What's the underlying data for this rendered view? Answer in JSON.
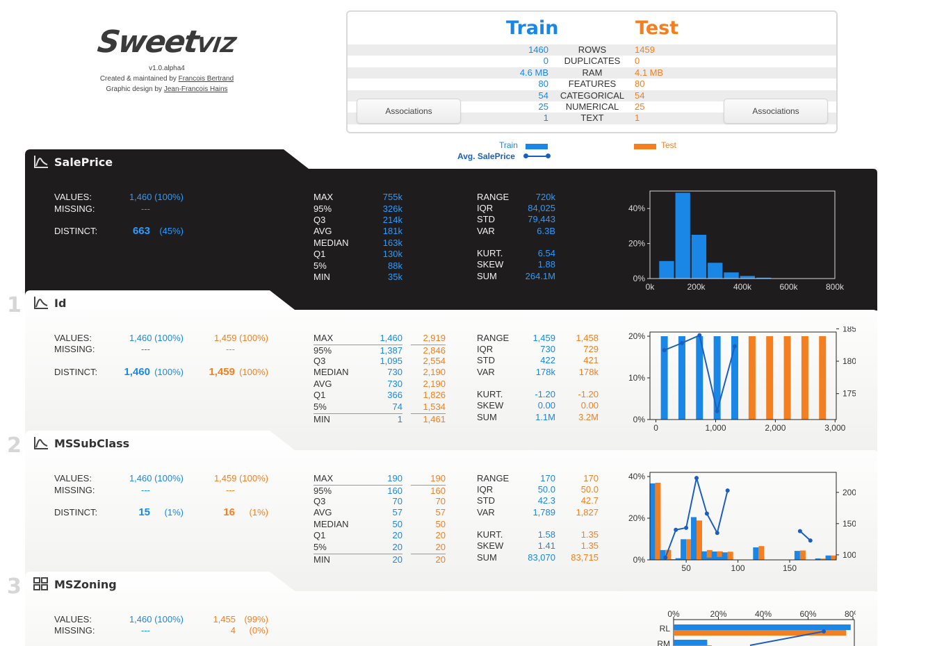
{
  "logo": {
    "word_main": "Sweet",
    "word_viz": "VIZ",
    "version": "v1.0.alpha4",
    "created_prefix": "Created & maintained by ",
    "created_name": "Francois Bertrand",
    "design_prefix": "Graphic design by ",
    "design_name": "Jean-Francois Hains"
  },
  "summary": {
    "train_label": "Train",
    "test_label": "Test",
    "rows": [
      {
        "label": "ROWS",
        "train": "1460",
        "test": "1459"
      },
      {
        "label": "DUPLICATES",
        "train": "0",
        "test": "0"
      },
      {
        "label": "RAM",
        "train": "4.6 MB",
        "test": "4.1 MB"
      },
      {
        "label": "FEATURES",
        "train": "80",
        "test": "80"
      },
      {
        "label": "CATEGORICAL",
        "train": "54",
        "test": "54"
      },
      {
        "label": "NUMERICAL",
        "train": "25",
        "test": "25"
      },
      {
        "label": "TEXT",
        "train": "1",
        "test": "1"
      }
    ],
    "associations_left": "Associations",
    "associations_right": "Associations"
  },
  "legend": {
    "train": "Train",
    "test": "Test",
    "avg": "Avg. SalePrice"
  },
  "colors": {
    "train": "#1a87e6",
    "test": "#f47f20",
    "avg_line": "#1a5fbf",
    "dark_bg": "#1e1c1c"
  },
  "features": {
    "saleprice": {
      "name": "SalePrice",
      "values_label": "VALUES:",
      "missing_label": "MISSING:",
      "distinct_label": "DISTINCT:",
      "values": "1,460 (100%)",
      "missing": "---",
      "distinct": "663",
      "distinct_pct": "(45%)",
      "quant_labels": [
        "MAX",
        "95%",
        "Q3",
        "AVG",
        "MEDIAN",
        "Q1",
        "5%",
        "MIN"
      ],
      "quant_train": [
        "755k",
        "326k",
        "214k",
        "181k",
        "163k",
        "130k",
        "88k",
        "35k"
      ],
      "stat_labels": [
        "RANGE",
        "IQR",
        "STD",
        "VAR"
      ],
      "stat_train": [
        "720k",
        "84,025",
        "79,443",
        "6.3B"
      ],
      "shape_labels": [
        "KURT.",
        "SKEW",
        "SUM"
      ],
      "shape_train": [
        "6.54",
        "1.88",
        "264.1M"
      ]
    },
    "id": {
      "index": "1",
      "name": "Id",
      "values_label": "VALUES:",
      "missing_label": "MISSING:",
      "distinct_label": "DISTINCT:",
      "values_train": "1,460 (100%)",
      "values_test": "1,459 (100%)",
      "missing_train": "---",
      "missing_test": "---",
      "distinct_train": "1,460",
      "distinct_train_pct": "(100%)",
      "distinct_test": "1,459",
      "distinct_test_pct": "(100%)",
      "quant_labels": [
        "MAX",
        "95%",
        "Q3",
        "MEDIAN",
        "AVG",
        "Q1",
        "5%",
        "MIN"
      ],
      "quant_train": [
        "1,460",
        "1,387",
        "1,095",
        "730",
        "730",
        "366",
        "74",
        "1"
      ],
      "quant_test": [
        "2,919",
        "2,846",
        "2,554",
        "2,190",
        "2,190",
        "1,826",
        "1,534",
        "1,461"
      ],
      "stat_labels": [
        "RANGE",
        "IQR",
        "STD",
        "VAR"
      ],
      "stat_train": [
        "1,459",
        "730",
        "422",
        "178k"
      ],
      "stat_test": [
        "1,458",
        "729",
        "421",
        "178k"
      ],
      "shape_labels": [
        "KURT.",
        "SKEW",
        "SUM"
      ],
      "shape_train": [
        "-1.20",
        "0.00",
        "1.1M"
      ],
      "shape_test": [
        "-1.20",
        "0.00",
        "3.2M"
      ]
    },
    "mssubclass": {
      "index": "2",
      "name": "MSSubClass",
      "values_label": "VALUES:",
      "missing_label": "MISSING:",
      "distinct_label": "DISTINCT:",
      "values_train": "1,460 (100%)",
      "values_test": "1,459 (100%)",
      "missing_train": "---",
      "missing_test": "---",
      "distinct_train": "15",
      "distinct_train_pct": "(1%)",
      "distinct_test": "16",
      "distinct_test_pct": "(1%)",
      "quant_labels": [
        "MAX",
        "95%",
        "Q3",
        "AVG",
        "MEDIAN",
        "Q1",
        "5%",
        "MIN"
      ],
      "quant_train": [
        "190",
        "160",
        "70",
        "57",
        "50",
        "20",
        "20",
        "20"
      ],
      "quant_test": [
        "190",
        "160",
        "70",
        "57",
        "50",
        "20",
        "20",
        "20"
      ],
      "stat_labels": [
        "RANGE",
        "IQR",
        "STD",
        "VAR"
      ],
      "stat_train": [
        "170",
        "50.0",
        "42.3",
        "1,789"
      ],
      "stat_test": [
        "170",
        "50.0",
        "42.7",
        "1,827"
      ],
      "shape_labels": [
        "KURT.",
        "SKEW",
        "SUM"
      ],
      "shape_train": [
        "1.58",
        "1.41",
        "83,070"
      ],
      "shape_test": [
        "1.35",
        "1.35",
        "83,715"
      ]
    },
    "mszoning": {
      "index": "3",
      "name": "MSZoning",
      "values_label": "VALUES:",
      "missing_label": "MISSING:",
      "values_train": "1,460 (100%)",
      "values_test": "1,455",
      "values_test_pct": "(99%)",
      "missing_train": "---",
      "missing_test": "4",
      "missing_test_pct": "(0%)"
    }
  },
  "chart_data": [
    {
      "type": "bar",
      "feature": "SalePrice",
      "x_ticks": [
        "0k",
        "200k",
        "400k",
        "600k",
        "800k"
      ],
      "y_ticks": [
        "0%",
        "20%",
        "40%"
      ],
      "xlim": [
        0,
        800000
      ],
      "ylim": [
        0,
        0.5
      ],
      "bin_starts": [
        40000,
        110000,
        180000,
        250000,
        320000,
        390000,
        460000,
        530000,
        600000,
        670000
      ],
      "bin_width": 64000,
      "values": [
        0.1,
        0.49,
        0.25,
        0.09,
        0.035,
        0.015,
        0.005,
        0.002,
        0.001,
        0.001
      ]
    },
    {
      "type": "bar",
      "feature": "Id",
      "x_ticks": [
        "0",
        "1,000",
        "2,000",
        "3,000"
      ],
      "y_ticks": [
        "0%",
        "10%",
        "20%"
      ],
      "y2_ticks": [
        "175k",
        "180k",
        "185k"
      ],
      "xlim": [
        -100,
        3020
      ],
      "ylim": [
        0,
        0.2
      ],
      "y2lim": [
        171000,
        184500
      ],
      "train_x": [
        140,
        435,
        730,
        1025,
        1320
      ],
      "train_values": [
        0.2,
        0.2,
        0.2,
        0.2,
        0.2
      ],
      "test_x": [
        1610,
        1905,
        2200,
        2495,
        2790
      ],
      "test_values": [
        0.2,
        0.2,
        0.2,
        0.2,
        0.2
      ],
      "avg_x": [
        140,
        435,
        730,
        1025,
        1320
      ],
      "avg_values": [
        181700,
        182800,
        184000,
        172300,
        182300
      ]
    },
    {
      "type": "bar",
      "feature": "MSSubClass",
      "x_ticks": [
        "50",
        "100",
        "150"
      ],
      "y_ticks": [
        "0%",
        "20%",
        "40%"
      ],
      "y2_ticks": [
        "100k",
        "150k",
        "200k"
      ],
      "xlim": [
        15,
        195
      ],
      "ylim": [
        0,
        0.42
      ],
      "y2lim": [
        92000,
        232000
      ],
      "categories": [
        20,
        30,
        40,
        45,
        50,
        60,
        70,
        75,
        80,
        85,
        90,
        120,
        150,
        160,
        180,
        190
      ],
      "train_values": [
        0.367,
        0.047,
        0.003,
        0.008,
        0.099,
        0.205,
        0.041,
        0.011,
        0.04,
        0.014,
        0.036,
        0.06,
        0.0,
        0.043,
        0.007,
        0.021
      ],
      "test_values": [
        0.37,
        0.048,
        0.001,
        0.003,
        0.099,
        0.189,
        0.047,
        0.005,
        0.041,
        0.019,
        0.039,
        0.066,
        0.001,
        0.045,
        0.006,
        0.021
      ],
      "avg_x": [
        30,
        40,
        50,
        60,
        70,
        80,
        90,
        100,
        160,
        170
      ],
      "avg_values": [
        95800,
        140000,
        143300,
        223000,
        166000,
        135000,
        203000,
        null,
        138000,
        123000
      ]
    },
    {
      "type": "bar",
      "feature": "MSZoning",
      "orientation": "horizontal",
      "x_ticks": [
        "0%",
        "20%",
        "40%",
        "60%",
        "80%"
      ],
      "xlim": [
        0,
        0.82
      ],
      "categories": [
        "RL",
        "RM"
      ],
      "train_values": [
        0.79,
        0.15
      ],
      "test_values": [
        0.77,
        0.17
      ]
    }
  ]
}
